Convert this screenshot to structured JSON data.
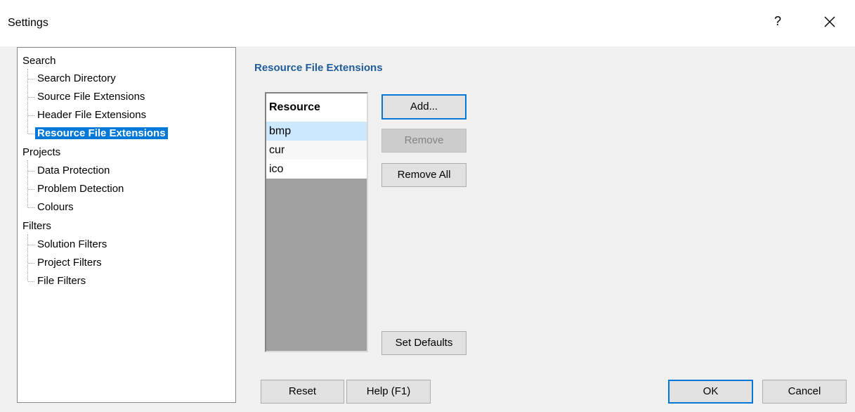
{
  "window": {
    "title": "Settings",
    "help_glyph": "?",
    "close_icon": "close-icon"
  },
  "tree": {
    "groups": [
      {
        "label": "Search",
        "children": [
          "Search Directory",
          "Source File Extensions",
          "Header File Extensions",
          "Resource File Extensions"
        ]
      },
      {
        "label": "Projects",
        "children": [
          "Data Protection",
          "Problem Detection",
          "Colours"
        ]
      },
      {
        "label": "Filters",
        "children": [
          "Solution Filters",
          "Project Filters",
          "File Filters"
        ]
      }
    ],
    "selected": "Resource File Extensions"
  },
  "panel": {
    "title": "Resource File Extensions",
    "list_header": "Resource",
    "items": [
      "bmp",
      "cur",
      "ico"
    ],
    "selected_item": "bmp"
  },
  "buttons": {
    "add": "Add...",
    "remove": "Remove",
    "remove_all": "Remove All",
    "set_defaults": "Set Defaults",
    "reset": "Reset",
    "help": "Help (F1)",
    "ok": "OK",
    "cancel": "Cancel"
  },
  "colors": {
    "accent": "#0078d7",
    "section_title": "#1f5c99",
    "selected_row": "#cce8ff"
  }
}
